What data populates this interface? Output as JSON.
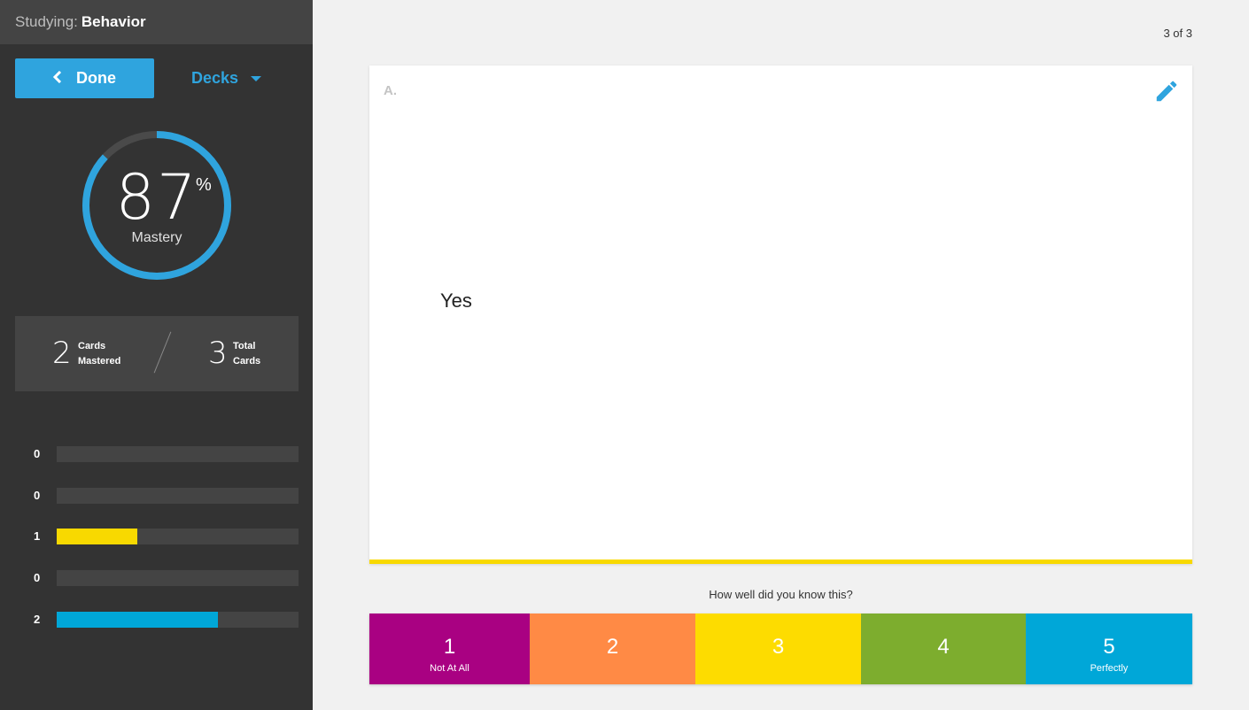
{
  "sidebar": {
    "header_prefix": "Studying:",
    "deck_name": "Behavior",
    "done_label": "Done",
    "done_icon": "chevron-left-icon",
    "decks_label": "Decks",
    "decks_icon": "caret-down-icon",
    "mastery_value": "87",
    "mastery_percent_sign": "%",
    "mastery_label": "Mastery",
    "mastery_fraction": 0.87,
    "stats": {
      "mastered_count": "2",
      "mastered_label_line1": "Cards",
      "mastered_label_line2": "Mastered",
      "total_count": "3",
      "total_label_line1": "Total",
      "total_label_line2": "Cards"
    },
    "confidence_bars": [
      {
        "count": "0",
        "fraction": 0,
        "color": "#444444"
      },
      {
        "count": "0",
        "fraction": 0,
        "color": "#444444"
      },
      {
        "count": "1",
        "fraction": 0.333,
        "color": "#f8d900"
      },
      {
        "count": "0",
        "fraction": 0,
        "color": "#444444"
      },
      {
        "count": "2",
        "fraction": 0.667,
        "color": "#00a7d8"
      }
    ]
  },
  "main": {
    "counter": "3 of 3",
    "card": {
      "side_label": "A.",
      "answer_text": "Yes",
      "edit_icon": "pencil-icon"
    },
    "question": "How well did you know this?",
    "ratings": [
      {
        "value": "1",
        "caption": "Not At All",
        "color": "#a90182"
      },
      {
        "value": "2",
        "caption": "",
        "color": "#ff8a45"
      },
      {
        "value": "3",
        "caption": "",
        "color": "#fddc00"
      },
      {
        "value": "4",
        "caption": "",
        "color": "#7dad2e"
      },
      {
        "value": "5",
        "caption": "Perfectly",
        "color": "#00a7d8"
      }
    ]
  },
  "colors": {
    "accent": "#2fa4de",
    "sidebar_bg": "#333333",
    "ring_track": "#4a4a4a"
  }
}
